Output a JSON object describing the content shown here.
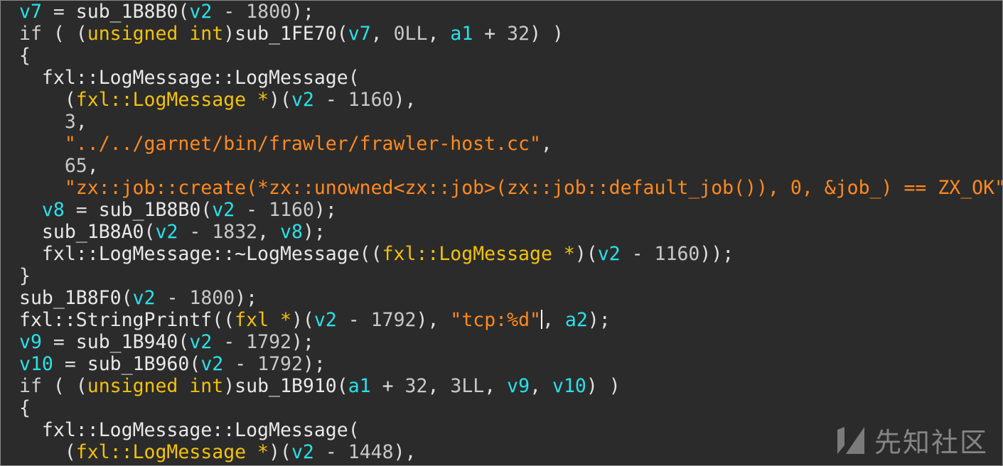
{
  "watermark": {
    "text": "先知社区"
  },
  "colors": {
    "background": "#2b2b2b",
    "identifier": "#e8e8e8",
    "variable": "#29e1e9",
    "keyword": "#cfcfcf",
    "type": "#f2c20c",
    "number": "#c8c8c8",
    "string": "#ff8a1f"
  },
  "code": {
    "lines": [
      [
        [
          "var",
          "v7"
        ],
        [
          "op",
          " = "
        ],
        [
          "id",
          "sub_1B8B0"
        ],
        [
          "punct",
          "("
        ],
        [
          "var",
          "v2"
        ],
        [
          "op",
          " - "
        ],
        [
          "num",
          "1800"
        ],
        [
          "punct",
          ");"
        ]
      ],
      [
        [
          "kw",
          "if"
        ],
        [
          "punct",
          " ( ("
        ],
        [
          "type",
          "unsigned int"
        ],
        [
          "punct",
          ")"
        ],
        [
          "id",
          "sub_1FE70"
        ],
        [
          "punct",
          "("
        ],
        [
          "var",
          "v7"
        ],
        [
          "punct",
          ", "
        ],
        [
          "num",
          "0LL"
        ],
        [
          "punct",
          ", "
        ],
        [
          "var",
          "a1"
        ],
        [
          "op",
          " + "
        ],
        [
          "num",
          "32"
        ],
        [
          "punct",
          ") )"
        ]
      ],
      [
        [
          "punct",
          "{"
        ]
      ],
      [
        [
          "punct",
          "  "
        ],
        [
          "id",
          "fxl::LogMessage::LogMessage"
        ],
        [
          "punct",
          "("
        ]
      ],
      [
        [
          "punct",
          "    ("
        ],
        [
          "type",
          "fxl::LogMessage *"
        ],
        [
          "punct",
          ")("
        ],
        [
          "var",
          "v2"
        ],
        [
          "op",
          " - "
        ],
        [
          "num",
          "1160"
        ],
        [
          "punct",
          "),"
        ]
      ],
      [
        [
          "punct",
          "    "
        ],
        [
          "num",
          "3"
        ],
        [
          "punct",
          ","
        ]
      ],
      [
        [
          "punct",
          "    "
        ],
        [
          "str",
          "\"../../garnet/bin/frawler/frawler-host.cc\""
        ],
        [
          "punct",
          ","
        ]
      ],
      [
        [
          "punct",
          "    "
        ],
        [
          "num",
          "65"
        ],
        [
          "punct",
          ","
        ]
      ],
      [
        [
          "punct",
          "    "
        ],
        [
          "str",
          "\"zx::job::create(*zx::unowned<zx::job>(zx::job::default_job()), 0, &job_) == ZX_OK\""
        ],
        [
          "punct",
          ");"
        ]
      ],
      [
        [
          "punct",
          "  "
        ],
        [
          "var",
          "v8"
        ],
        [
          "op",
          " = "
        ],
        [
          "id",
          "sub_1B8B0"
        ],
        [
          "punct",
          "("
        ],
        [
          "var",
          "v2"
        ],
        [
          "op",
          " - "
        ],
        [
          "num",
          "1160"
        ],
        [
          "punct",
          ");"
        ]
      ],
      [
        [
          "punct",
          "  "
        ],
        [
          "id",
          "sub_1B8A0"
        ],
        [
          "punct",
          "("
        ],
        [
          "var",
          "v2"
        ],
        [
          "op",
          " - "
        ],
        [
          "num",
          "1832"
        ],
        [
          "punct",
          ", "
        ],
        [
          "var",
          "v8"
        ],
        [
          "punct",
          ");"
        ]
      ],
      [
        [
          "punct",
          "  "
        ],
        [
          "id",
          "fxl::LogMessage::~LogMessage"
        ],
        [
          "punct",
          "(("
        ],
        [
          "type",
          "fxl::LogMessage *"
        ],
        [
          "punct",
          ")("
        ],
        [
          "var",
          "v2"
        ],
        [
          "op",
          " - "
        ],
        [
          "num",
          "1160"
        ],
        [
          "punct",
          "));"
        ]
      ],
      [
        [
          "punct",
          "}"
        ]
      ],
      [
        [
          "id",
          "sub_1B8F0"
        ],
        [
          "punct",
          "("
        ],
        [
          "var",
          "v2"
        ],
        [
          "op",
          " - "
        ],
        [
          "num",
          "1800"
        ],
        [
          "punct",
          ");"
        ]
      ],
      [
        [
          "id",
          "fxl::StringPrintf"
        ],
        [
          "punct",
          "(("
        ],
        [
          "type",
          "fxl *"
        ],
        [
          "punct",
          ")("
        ],
        [
          "var",
          "v2"
        ],
        [
          "op",
          " - "
        ],
        [
          "num",
          "1792"
        ],
        [
          "punct",
          "), "
        ],
        [
          "str",
          "\"tcp:%d\""
        ],
        [
          "cursor",
          ""
        ],
        [
          "punct",
          ", "
        ],
        [
          "var",
          "a2"
        ],
        [
          "punct",
          ");"
        ]
      ],
      [
        [
          "var",
          "v9"
        ],
        [
          "op",
          " = "
        ],
        [
          "id",
          "sub_1B940"
        ],
        [
          "punct",
          "("
        ],
        [
          "var",
          "v2"
        ],
        [
          "op",
          " - "
        ],
        [
          "num",
          "1792"
        ],
        [
          "punct",
          ");"
        ]
      ],
      [
        [
          "var",
          "v10"
        ],
        [
          "op",
          " = "
        ],
        [
          "id",
          "sub_1B960"
        ],
        [
          "punct",
          "("
        ],
        [
          "var",
          "v2"
        ],
        [
          "op",
          " - "
        ],
        [
          "num",
          "1792"
        ],
        [
          "punct",
          ");"
        ]
      ],
      [
        [
          "kw",
          "if"
        ],
        [
          "punct",
          " ( ("
        ],
        [
          "type",
          "unsigned int"
        ],
        [
          "punct",
          ")"
        ],
        [
          "id",
          "sub_1B910"
        ],
        [
          "punct",
          "("
        ],
        [
          "var",
          "a1"
        ],
        [
          "op",
          " + "
        ],
        [
          "num",
          "32"
        ],
        [
          "punct",
          ", "
        ],
        [
          "num",
          "3LL"
        ],
        [
          "punct",
          ", "
        ],
        [
          "var",
          "v9"
        ],
        [
          "punct",
          ", "
        ],
        [
          "var",
          "v10"
        ],
        [
          "punct",
          ") )"
        ]
      ],
      [
        [
          "punct",
          "{"
        ]
      ],
      [
        [
          "punct",
          "  "
        ],
        [
          "id",
          "fxl::LogMessage::LogMessage"
        ],
        [
          "punct",
          "("
        ]
      ],
      [
        [
          "punct",
          "    ("
        ],
        [
          "type",
          "fxl::LogMessage *"
        ],
        [
          "punct",
          ")("
        ],
        [
          "var",
          "v2"
        ],
        [
          "op",
          " - "
        ],
        [
          "num",
          "1448"
        ],
        [
          "punct",
          "),"
        ]
      ]
    ]
  }
}
